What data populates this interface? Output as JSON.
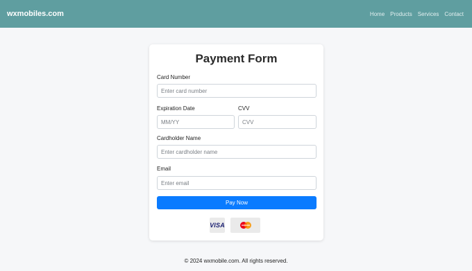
{
  "navbar": {
    "brand": "wxmobiles.com",
    "links": [
      "Home",
      "Products",
      "Services",
      "Contact"
    ]
  },
  "form": {
    "title": "Payment Form",
    "card_number": {
      "label": "Card Number",
      "placeholder": "Enter card number"
    },
    "expiration": {
      "label": "Expiration Date",
      "placeholder": "MM/YY"
    },
    "cvv": {
      "label": "CVV",
      "placeholder": "CVV"
    },
    "cardholder": {
      "label": "Cardholder Name",
      "placeholder": "Enter cardholder name"
    },
    "email": {
      "label": "Email",
      "placeholder": "Enter email"
    },
    "submit_label": "Pay Now"
  },
  "payment_icons": {
    "visa": "VISA",
    "mastercard_icon": "mastercard-logo-icon"
  },
  "footer": {
    "text": "© 2024 wxmobile.com. All rights reserved."
  },
  "colors": {
    "navbar": "#5f9ea0",
    "primary_button": "#0a7bff",
    "background": "#f6f7f9"
  }
}
